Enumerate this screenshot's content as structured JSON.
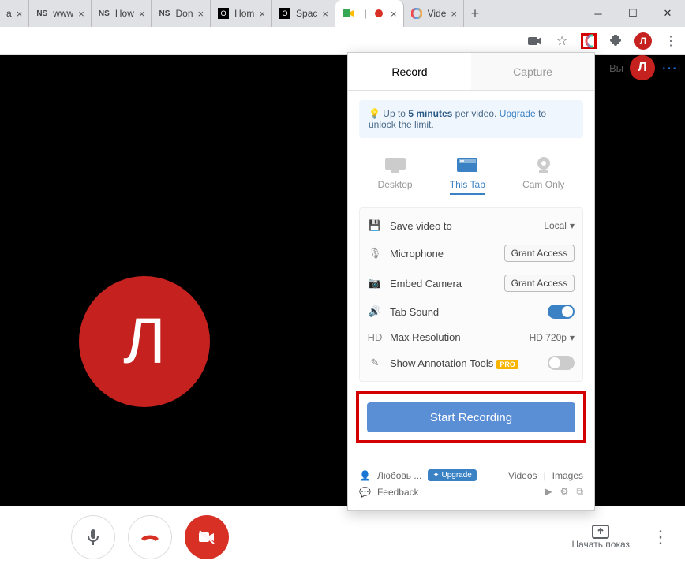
{
  "browser": {
    "tabs": [
      {
        "title": "a"
      },
      {
        "title": "www"
      },
      {
        "title": "How"
      },
      {
        "title": "Don"
      },
      {
        "title": "Hom"
      },
      {
        "title": "Spac"
      },
      {
        "title": ""
      },
      {
        "title": "Vide"
      }
    ],
    "avatar_letter": "Л"
  },
  "meet": {
    "header_text": "Вы",
    "header_avatar": "Л",
    "avatar_letter": "Л",
    "present_label": "Начать показ"
  },
  "popup": {
    "tab_record": "Record",
    "tab_capture": "Capture",
    "banner_prefix": "Up to ",
    "banner_bold": "5 minutes",
    "banner_mid": " per video. ",
    "banner_link": "Upgrade",
    "banner_suffix": " to unlock the limit.",
    "modes": {
      "desktop": "Desktop",
      "this_tab": "This Tab",
      "cam_only": "Cam Only"
    },
    "settings": {
      "save_label": "Save video to",
      "save_value": "Local",
      "mic_label": "Microphone",
      "mic_btn": "Grant Access",
      "cam_label": "Embed Camera",
      "cam_btn": "Grant Access",
      "sound_label": "Tab Sound",
      "res_label": "Max Resolution",
      "res_value": "HD 720p",
      "anno_label": "Show Annotation Tools",
      "pro": "PRO"
    },
    "start_btn": "Start Recording",
    "footer": {
      "user": "Любовь ...",
      "upgrade": "✦ Upgrade",
      "videos": "Videos",
      "images": "Images",
      "feedback": "Feedback"
    }
  }
}
